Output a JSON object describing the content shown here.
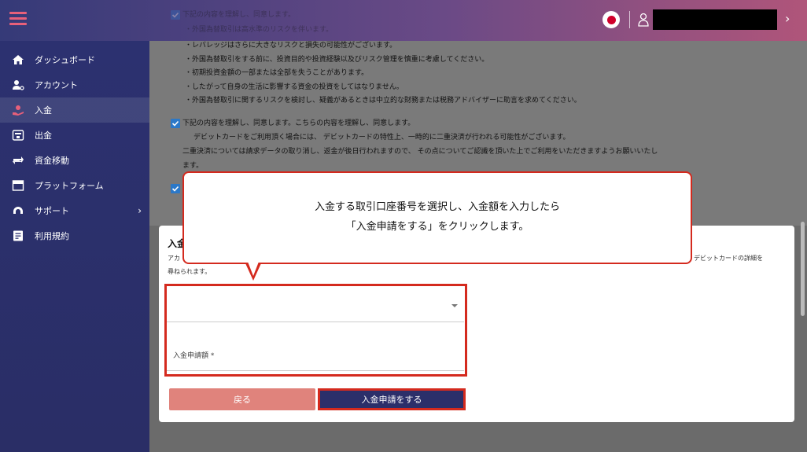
{
  "colors": {
    "accent": "#e8607a",
    "navy": "#2b2f6a",
    "highlight": "#d42a1e",
    "checkbox": "#2b78c8",
    "back_button": "#e0837c"
  },
  "sidebar": {
    "items": [
      {
        "icon": "home-icon",
        "label": "ダッシュボード"
      },
      {
        "icon": "account-icon",
        "label": "アカウント"
      },
      {
        "icon": "deposit-icon",
        "label": "入金",
        "active": true
      },
      {
        "icon": "withdraw-icon",
        "label": "出金"
      },
      {
        "icon": "transfer-icon",
        "label": "資金移動"
      },
      {
        "icon": "platform-icon",
        "label": "プラットフォーム"
      },
      {
        "icon": "support-icon",
        "label": "サポート",
        "has_submenu": true
      },
      {
        "icon": "terms-icon",
        "label": "利用規約"
      }
    ]
  },
  "notice": {
    "top_checkbox_label": "下記の内容を理解し、同意します。",
    "top_faded_line": "・外国為替取引は高水準のリスクを伴います。",
    "risk_lines": [
      "・レバレッジはさらに大きなリスクと損失の可能性がございます。",
      "・外国為替取引をする前に、投資目的や投資経験以及びリスク管理を慎重に考慮してください。",
      "・初期投資金額の一部または全部を失うことがあります。",
      "・したがって自身の生活に影響する資金の投資をしてはなりません。",
      "・外国為替取引に関するリスクを検討し、疑義があるときは中立的な財務または税務アドバイザーに助言を求めてください。"
    ],
    "debit_checkbox_label": "下記の内容を理解し、同意します。こちらの内容を理解し、同意します。",
    "debit_lines": [
      "デビットカードをご利用頂く場合には、 デビットカードの特性上、一時的に二重決済が行われる可能性がございます。",
      "二重決済については請求データの取り消し、返金が後日行われますので、 その点についてご認識を頂いた上でご利用をいただきますようお願いいたし",
      "ます。"
    ]
  },
  "form": {
    "section_title_partial": "入金",
    "desc_left": "アカ",
    "desc_right": "デビットカードの詳細を",
    "desc_line2": "尋ねられます。",
    "select_value": "",
    "amount_placeholder": "入金申請額 *",
    "back_label": "戻る",
    "submit_label": "入金申請をする"
  },
  "callout": {
    "line1": "入金する取引口座番号を選択し、入金額を入力したら",
    "line2": "「入金申請をする」をクリックします。"
  }
}
